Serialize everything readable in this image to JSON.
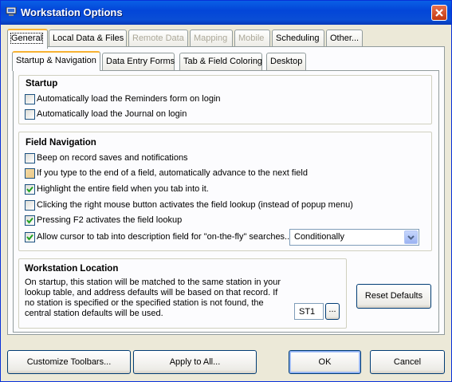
{
  "window": {
    "title": "Workstation Options"
  },
  "tabs": [
    {
      "label": "General",
      "hotkey": "G",
      "rest": "eneral",
      "enabled": true,
      "active": true
    },
    {
      "label": "Local Data & Files",
      "enabled": true
    },
    {
      "label": "Remote Data",
      "enabled": false
    },
    {
      "label": "Mapping",
      "enabled": false
    },
    {
      "label": "Mobile",
      "enabled": false
    },
    {
      "label": "Scheduling",
      "enabled": true
    },
    {
      "label": "Other...",
      "enabled": true
    }
  ],
  "subtabs": [
    {
      "label": "Startup & Navigation",
      "active": true
    },
    {
      "label": "Data Entry Forms"
    },
    {
      "label": "Tab & Field Coloring"
    },
    {
      "label": "Desktop"
    }
  ],
  "startup": {
    "title": "Startup",
    "options": [
      {
        "label": "Automatically load the Reminders form on login",
        "checked": false
      },
      {
        "label": "Automatically load the Journal on login",
        "checked": false
      }
    ]
  },
  "field_navigation": {
    "title": "Field Navigation",
    "options": [
      {
        "label": "Beep on record saves and notifications",
        "checked": false
      },
      {
        "label": "If you type to the end of a field, automatically advance to the next field",
        "checked": false,
        "state": "partial"
      },
      {
        "label": "Highlight the entire field when you tab into it.",
        "checked": true
      },
      {
        "label": "Clicking the right mouse button activates the field lookup (instead of popup menu)",
        "checked": false
      },
      {
        "label": "Pressing F2 activates the field lookup",
        "checked": true
      },
      {
        "label": "Allow cursor to tab into description field for \"on-the-fly\" searches...",
        "checked": true
      }
    ],
    "dropdown_value": "Conditionally"
  },
  "workstation_location": {
    "title": "Workstation Location",
    "description": "On startup, this station will be matched to the same station in  your lookup table, and address defaults will be based on that record. If no station is specified or the specified station is not found, the central station defaults will be used.",
    "station_value": "ST1",
    "browse_label": "..."
  },
  "buttons": {
    "reset_defaults": "Reset Defaults",
    "customize_toolbars": "Customize Toolbars...",
    "apply_to_all": "Apply to All...",
    "ok": "OK",
    "cancel": "Cancel"
  }
}
